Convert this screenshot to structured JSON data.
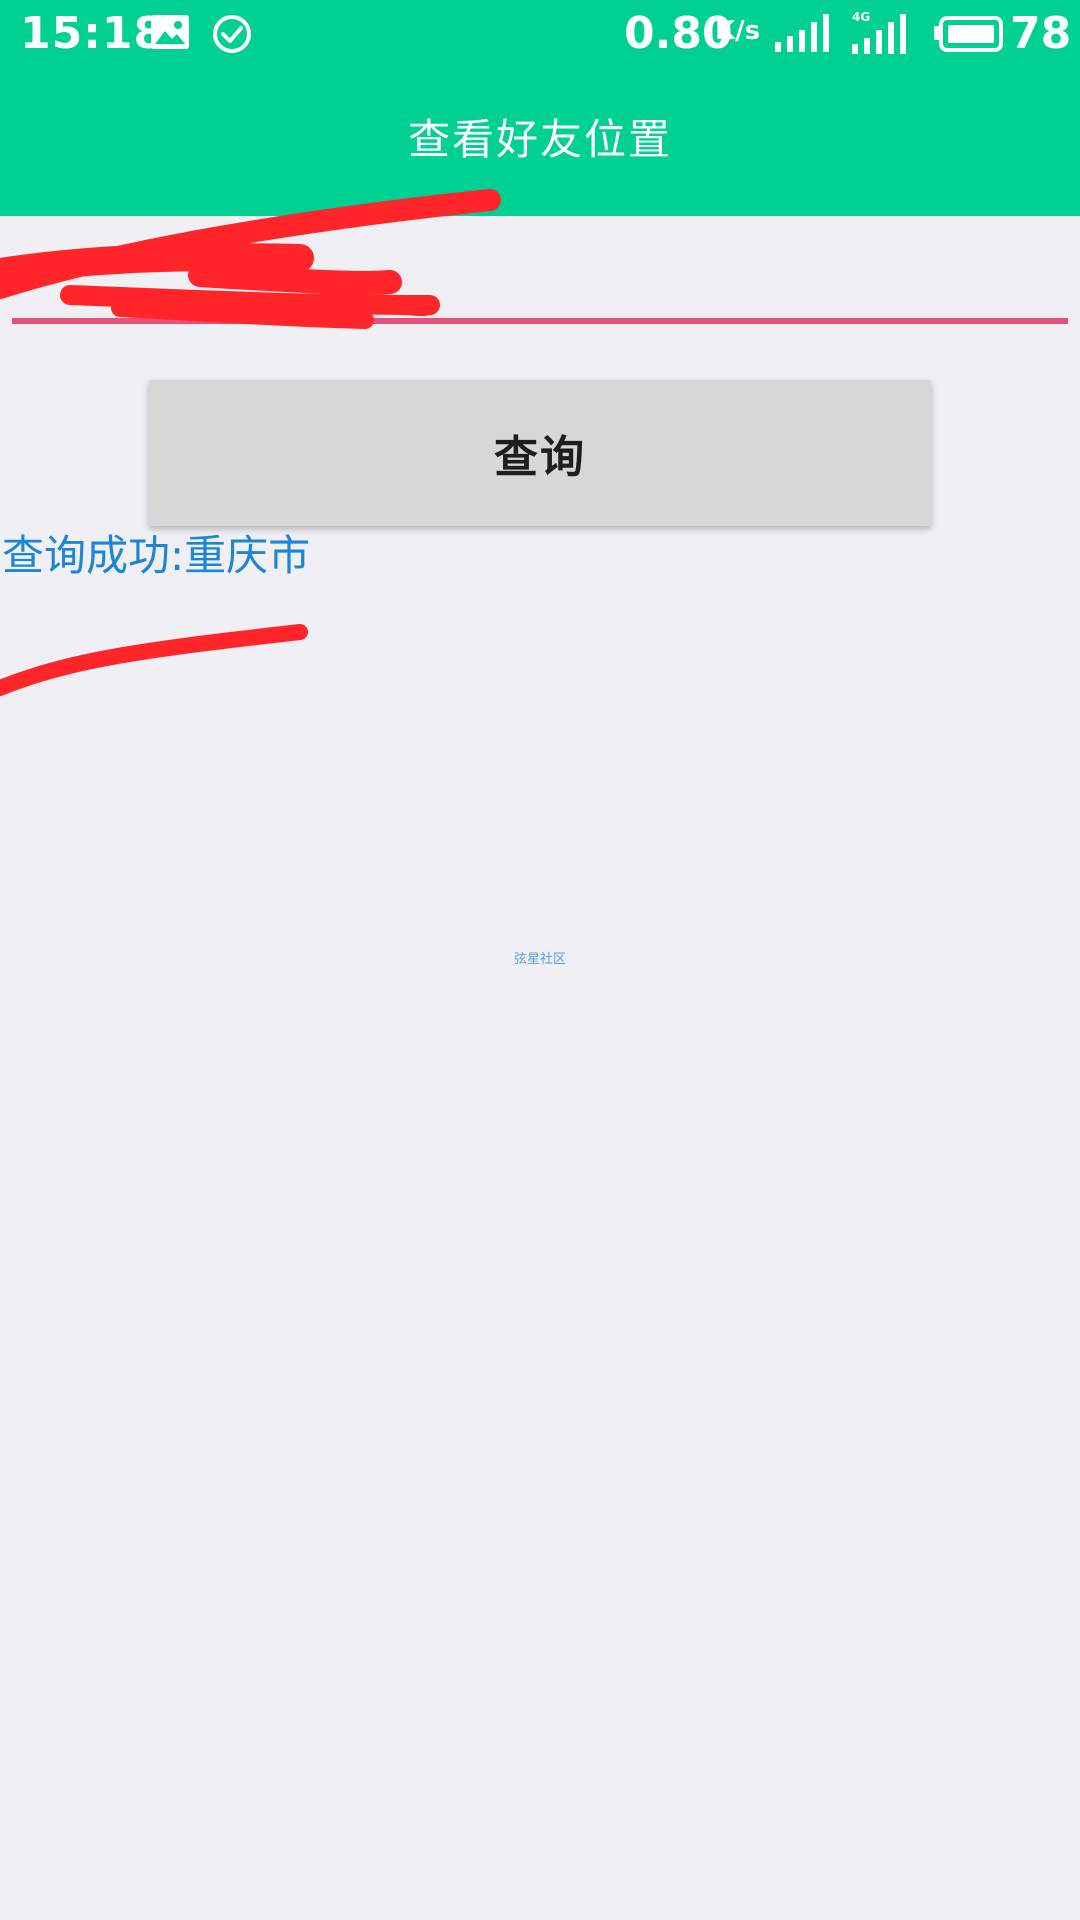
{
  "status_bar": {
    "time": "15:18",
    "net_speed": "0.80",
    "speed_unit": "K/s",
    "network_type": "4G",
    "battery_level": "78"
  },
  "header": {
    "title": "查看好友位置",
    "background_color": "#00d092"
  },
  "form": {
    "input_value": "",
    "input_underline_color": "#e8507c",
    "query_button_label": "查询"
  },
  "result": {
    "text": "查询成功:重庆市",
    "color": "#1b86d6"
  },
  "watermark": {
    "text": "弦星社区"
  },
  "icons": [
    "gallery-icon",
    "check-circle-icon",
    "signal-icon",
    "signal-4g-icon",
    "battery-icon"
  ]
}
